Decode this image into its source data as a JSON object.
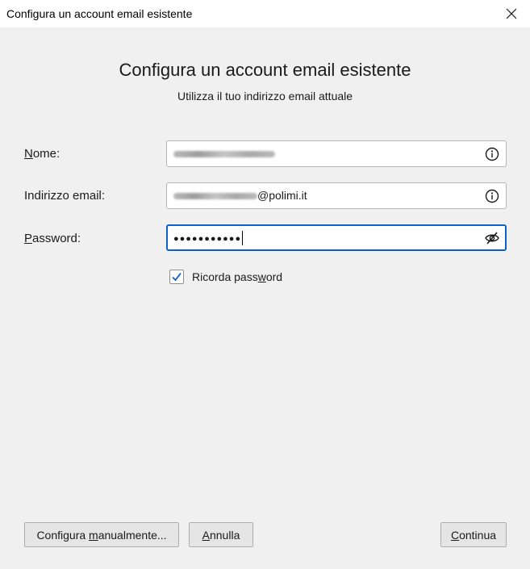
{
  "window": {
    "title": "Configura un account email esistente",
    "close_icon": "close-icon"
  },
  "header": {
    "title": "Configura un account email esistente",
    "subtitle": "Utilizza il tuo indirizzo email attuale"
  },
  "form": {
    "name": {
      "label_accel": "N",
      "label_rest": "ome:",
      "value": "",
      "icon": "info-icon"
    },
    "email": {
      "label": "Indirizzo email:",
      "value_visible": "@polimi.it",
      "icon": "info-icon"
    },
    "password": {
      "label_accel": "P",
      "label_rest": "assword:",
      "value": "●●●●●●●●●●●",
      "icon": "eye-slash-icon"
    },
    "remember": {
      "checked": true,
      "label_pre": "Ricorda pass",
      "label_accel": "w",
      "label_post": "ord"
    }
  },
  "buttons": {
    "manual": {
      "pre": "Configura ",
      "accel": "m",
      "post": "anualmente..."
    },
    "cancel": {
      "pre": "",
      "accel": "A",
      "post": "nnulla"
    },
    "continue": {
      "pre": "",
      "accel": "C",
      "post": "ontinua"
    }
  },
  "colors": {
    "focus_border": "#0a62c9",
    "checkmark": "#0a62c9",
    "background": "#f0f0f0"
  }
}
